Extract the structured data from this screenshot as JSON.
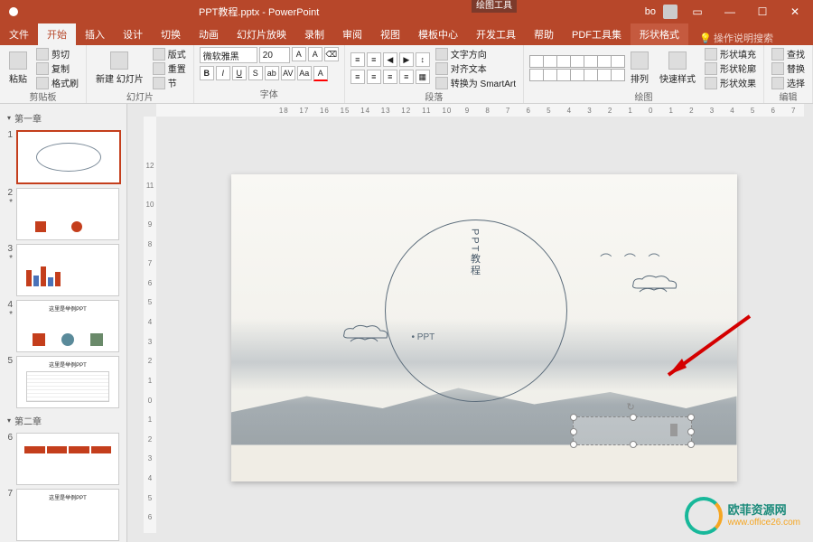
{
  "titlebar": {
    "title": "PPT教程.pptx - PowerPoint",
    "tool_tab": "绘图工具",
    "user": "bo"
  },
  "tabs": {
    "file": "文件",
    "home": "开始",
    "insert": "插入",
    "design": "设计",
    "transitions": "切换",
    "animations": "动画",
    "slideshow": "幻灯片放映",
    "record": "录制",
    "review": "审阅",
    "view": "视图",
    "template": "模板中心",
    "developer": "开发工具",
    "help": "帮助",
    "pdf": "PDF工具集",
    "format": "形状格式",
    "tell": "操作说明搜索"
  },
  "ribbon": {
    "clipboard": {
      "label": "剪贴板",
      "cut": "剪切",
      "copy": "复制",
      "paste": "粘贴",
      "painter": "格式刷"
    },
    "slides": {
      "label": "幻灯片",
      "new": "新建\n幻灯片",
      "layout": "版式",
      "reset": "重置",
      "section": "节"
    },
    "font": {
      "label": "字体",
      "name": "微软雅黑",
      "size": "20"
    },
    "paragraph": {
      "label": "段落",
      "dir": "文字方向",
      "align": "对齐文本",
      "smart": "转换为 SmartArt"
    },
    "drawing": {
      "label": "绘图",
      "arrange": "排列",
      "quick": "快速样式",
      "fill": "形状填充",
      "outline": "形状轮廓",
      "effects": "形状效果"
    },
    "editing": {
      "label": "编辑",
      "find": "查找",
      "replace": "替换",
      "select": "选择"
    }
  },
  "thumbs": {
    "section1": "第一章",
    "section2": "第二章",
    "nums": [
      "1",
      "2",
      "3",
      "4",
      "5",
      "6",
      "7"
    ],
    "t4": "这里是举例PPT",
    "t5": "这里是举例PPT",
    "t7": "这里是举例PPT"
  },
  "ruler_h": [
    "18",
    "17",
    "16",
    "15",
    "14",
    "13",
    "12",
    "11",
    "10",
    "9",
    "8",
    "7",
    "6",
    "5",
    "4",
    "3",
    "2",
    "1",
    "0",
    "1",
    "2",
    "3",
    "4",
    "5",
    "6",
    "7"
  ],
  "ruler_v": [
    "12",
    "11",
    "10",
    "9",
    "8",
    "7",
    "6",
    "5",
    "4",
    "3",
    "2",
    "1",
    "0",
    "1",
    "2",
    "3",
    "4",
    "5",
    "6"
  ],
  "slide": {
    "vtext": "PPT教程",
    "bullet": "• PPT",
    "textbox_cursor": "|"
  },
  "watermark": {
    "name": "欧菲资源网",
    "url": "www.office26.com"
  }
}
